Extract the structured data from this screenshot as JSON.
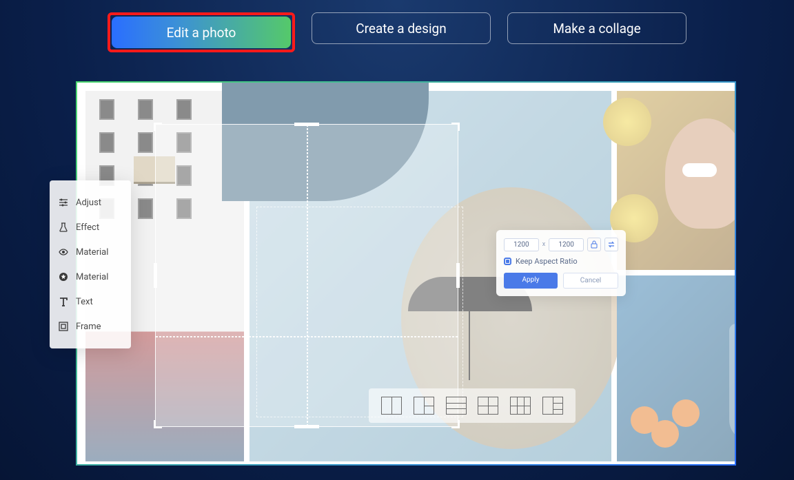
{
  "buttons": {
    "edit": "Edit a photo",
    "design": "Create a design",
    "collage": "Make a collage"
  },
  "sidebar": {
    "items": [
      {
        "label": "Adjust"
      },
      {
        "label": "Effect"
      },
      {
        "label": "Material"
      },
      {
        "label": "Material"
      },
      {
        "label": "Text"
      },
      {
        "label": "Frame"
      }
    ]
  },
  "resize": {
    "width": "1200",
    "height": "1200",
    "sep": "x",
    "keep_ratio": "Keep Aspect Ratio",
    "apply": "Apply",
    "cancel": "Cancel"
  }
}
